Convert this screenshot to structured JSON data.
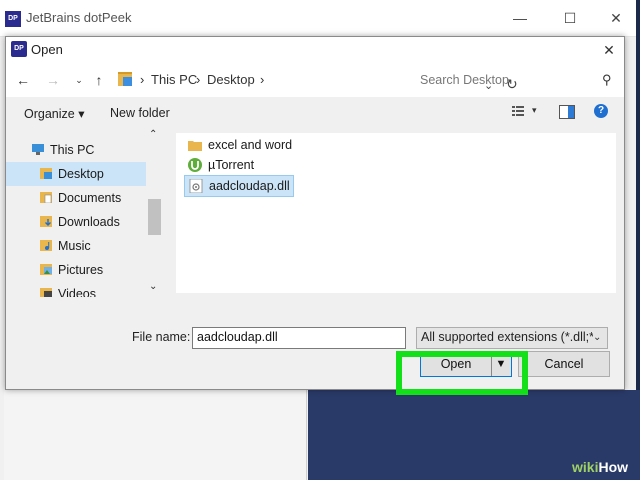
{
  "app": {
    "title": "JetBrains dotPeek",
    "icon_text": "DP",
    "minimize": "—",
    "maximize": "☐",
    "close": "✕"
  },
  "dialog": {
    "title": "Open",
    "icon_text": "DP",
    "close": "✕"
  },
  "navigation": {
    "back": "←",
    "forward": "→",
    "recent": "⌄",
    "up": "↑",
    "breadcrumb": [
      "This PC",
      "Desktop"
    ],
    "separator": "›",
    "dropdown": "⌄",
    "refresh": "↻",
    "search_placeholder": "Search Desktop",
    "search_icon": "⚲"
  },
  "toolbar": {
    "organize_label": "Organize ▾",
    "new_folder_label": "New folder",
    "view_caret": "▾",
    "help": "?"
  },
  "tree": [
    {
      "label": "This PC",
      "icon": "computer-icon"
    },
    {
      "label": "Desktop",
      "icon": "desktop-folder-icon",
      "selected": true
    },
    {
      "label": "Documents",
      "icon": "documents-folder-icon"
    },
    {
      "label": "Downloads",
      "icon": "downloads-folder-icon"
    },
    {
      "label": "Music",
      "icon": "music-folder-icon"
    },
    {
      "label": "Pictures",
      "icon": "pictures-folder-icon"
    },
    {
      "label": "Videos",
      "icon": "videos-folder-icon"
    }
  ],
  "scroll": {
    "up": "⌃",
    "down": "⌄"
  },
  "files": [
    {
      "name": "excel and word",
      "icon": "folder-icon"
    },
    {
      "name": "µTorrent",
      "icon": "utorrent-icon"
    },
    {
      "name": "aadcloudap.dll",
      "icon": "dll-file-icon",
      "selected": true
    }
  ],
  "footer": {
    "file_name_label": "File name:",
    "file_name_value": "aadcloudap.dll",
    "filter_value": "All supported extensions (*.dll;*",
    "filter_caret": "⌄",
    "open_label": "Open",
    "open_caret": "▼",
    "cancel_label": "Cancel"
  },
  "colors": {
    "highlight": "#14e01a",
    "selection": "#cce4f7",
    "accent": "#0078d7"
  },
  "watermark": {
    "prefix": "wiki",
    "suffix": "How"
  }
}
